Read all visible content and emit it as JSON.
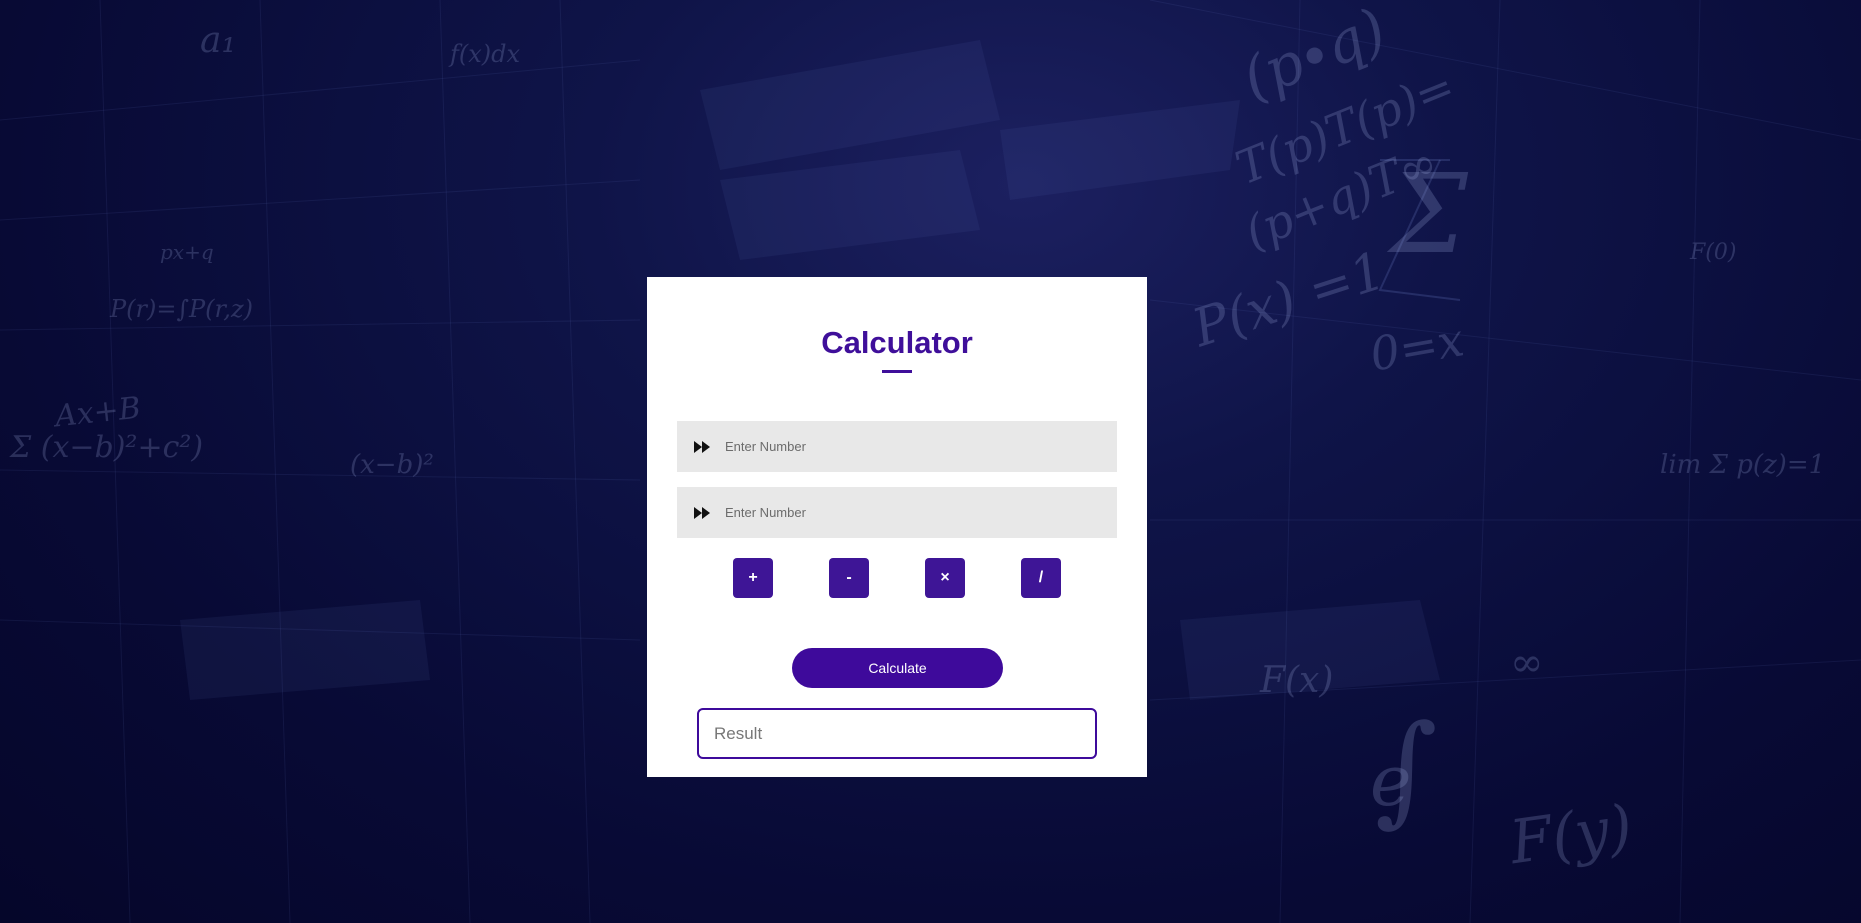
{
  "background": {
    "theme": "math-equations-dark-blue",
    "color": "#080a35",
    "equations": [
      "(p∙q)",
      "T(p)T(p)=",
      "(p+q)T∞",
      "P(x) =1",
      "0=x",
      "Σ",
      "∞",
      "F(x)",
      "Ax+B",
      "Σ (x−b)²+c²)",
      "P(r)=∫P(r,z)",
      "(x−b)²",
      "px+q",
      "F(0)",
      "lim Σ p(z)=1",
      "F(y)",
      "e",
      "∫",
      "a₁",
      "f(x)dx"
    ]
  },
  "calculator": {
    "title": "Calculator",
    "accent_color": "#3f0f9a",
    "inputs": [
      {
        "placeholder": "Enter Number",
        "value": "",
        "icon": "forward-icon"
      },
      {
        "placeholder": "Enter Number",
        "value": "",
        "icon": "forward-icon"
      }
    ],
    "operators": [
      {
        "label": "+",
        "name": "add"
      },
      {
        "label": "-",
        "name": "subtract"
      },
      {
        "label": "×",
        "name": "multiply"
      },
      {
        "label": "/",
        "name": "divide"
      }
    ],
    "calculate_label": "Calculate",
    "result_placeholder": "Result",
    "result_value": ""
  }
}
